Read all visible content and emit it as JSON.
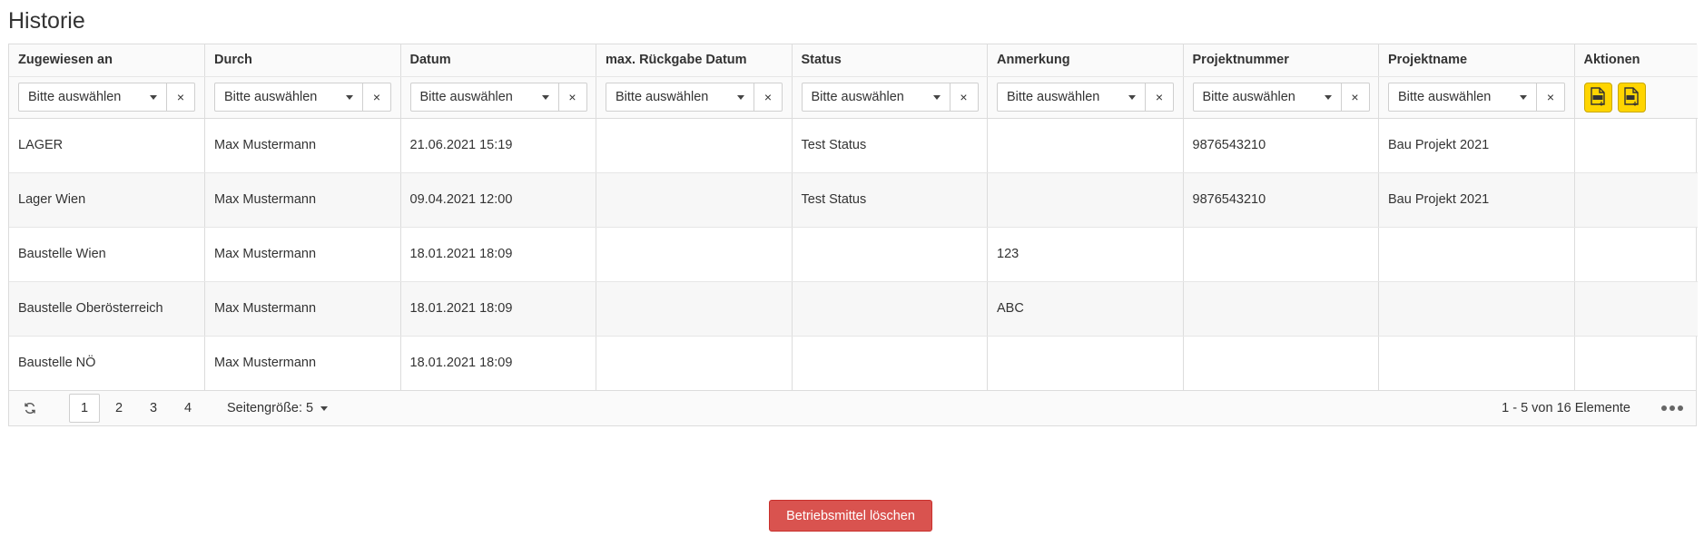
{
  "page": {
    "title": "Historie"
  },
  "columns": [
    "Zugewiesen an",
    "Durch",
    "Datum",
    "max. Rückgabe Datum",
    "Status",
    "Anmerkung",
    "Projektnummer",
    "Projektname",
    "Aktionen"
  ],
  "filters": {
    "placeholder": "Bitte auswählen",
    "clear_label": "×"
  },
  "actions": {
    "excel_icon": "excel-export-icon",
    "pdf_icon": "pdf-export-icon",
    "accent_color": "#ffd500"
  },
  "rows": [
    [
      "LAGER",
      "Max Mustermann",
      "21.06.2021 15:19",
      "",
      "Test Status",
      "",
      "9876543210",
      "Bau Projekt 2021"
    ],
    [
      "Lager Wien",
      "Max Mustermann",
      "09.04.2021 12:00",
      "",
      "Test Status",
      "",
      "9876543210",
      "Bau Projekt 2021"
    ],
    [
      "Baustelle Wien",
      "Max Mustermann",
      "18.01.2021 18:09",
      "",
      "",
      "123",
      "",
      ""
    ],
    [
      "Baustelle Oberösterreich",
      "Max Mustermann",
      "18.01.2021 18:09",
      "",
      "",
      "ABC",
      "",
      ""
    ],
    [
      "Baustelle NÖ",
      "Max Mustermann",
      "18.01.2021 18:09",
      "",
      "",
      "",
      "",
      ""
    ]
  ],
  "pager": {
    "pages": [
      "1",
      "2",
      "3",
      "4"
    ],
    "active_page": "1",
    "page_size_label": "Seitengröße: 5",
    "info": "1 - 5 von 16 Elemente"
  },
  "footer": {
    "delete_label": "Betriebsmittel löschen",
    "delete_color": "#d9534f"
  }
}
